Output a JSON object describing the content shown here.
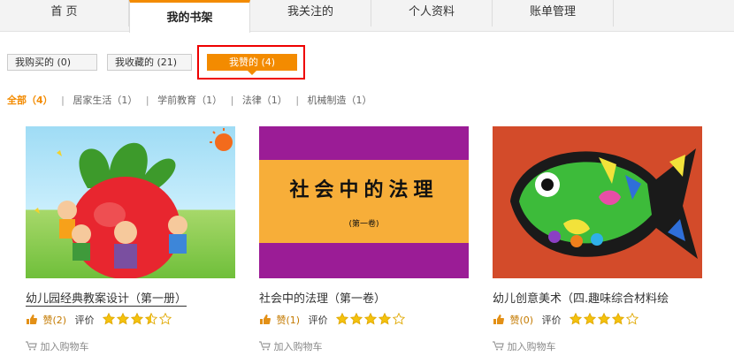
{
  "tabs": {
    "home": "首 页",
    "my_shelf": "我的书架",
    "following": "我关注的",
    "profile": "个人资料",
    "billing": "账单管理"
  },
  "subtabs": {
    "bought": "我购买的 (0)",
    "favorited": "我收藏的 (21)",
    "liked": "我赞的 (4)"
  },
  "filters": {
    "all": "全部（4）",
    "home_life": "居家生活（1）",
    "preschool": "学前教育（1）",
    "law": "法律（1）",
    "machinery": "机械制造（1）",
    "separator": "|"
  },
  "colors": {
    "accent": "#f38b00",
    "highlight": "#ee0000"
  },
  "products": [
    {
      "title": "幼儿园经典教案设计（第一册）",
      "like_label": "赞(2)",
      "rate_label": "评价",
      "rating": 3.5,
      "cart_label": "加入购物车"
    },
    {
      "title": "社会中的法理（第一卷）",
      "cover_title": "社会中的法理",
      "cover_subtitle": "(第一卷)",
      "like_label": "赞(1)",
      "rate_label": "评价",
      "rating": 4,
      "cart_label": "加入购物车"
    },
    {
      "title": "幼儿创意美术（四.趣味综合材料绘",
      "like_label": "赞(0)",
      "rate_label": "评价",
      "rating": 4,
      "cart_label": "加入购物车"
    }
  ]
}
